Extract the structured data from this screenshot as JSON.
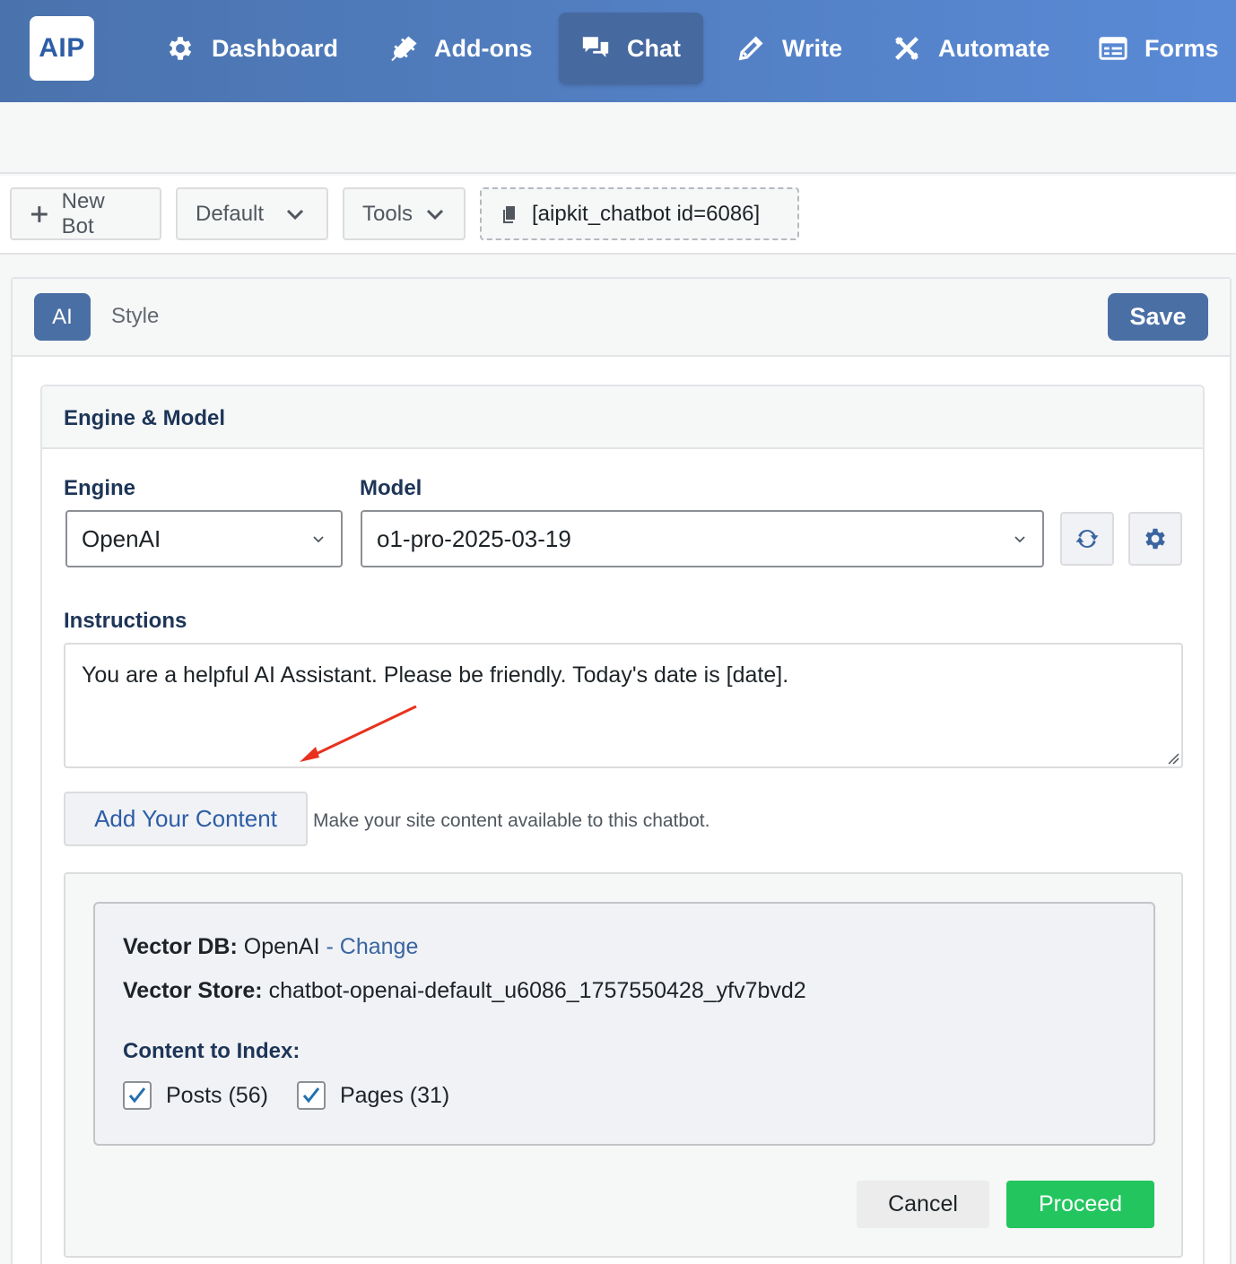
{
  "logo": "AIP",
  "nav": {
    "items": [
      {
        "label": "Dashboard",
        "icon": "gear-icon"
      },
      {
        "label": "Add-ons",
        "icon": "plug-icon"
      },
      {
        "label": "Chat",
        "icon": "chat-icon",
        "active": true
      },
      {
        "label": "Write",
        "icon": "pencil-icon"
      },
      {
        "label": "Automate",
        "icon": "automate-icon"
      },
      {
        "label": "Forms",
        "icon": "form-icon"
      }
    ]
  },
  "toolbar": {
    "new_bot": "New Bot",
    "bot_select": "Default",
    "tools": "Tools",
    "shortcode": "[aipkit_chatbot id=6086]"
  },
  "tabs": {
    "ai": "AI",
    "style": "Style",
    "save": "Save"
  },
  "engine_model": {
    "title": "Engine & Model",
    "engine_label": "Engine",
    "engine_value": "OpenAI",
    "model_label": "Model",
    "model_value": "o1-pro-2025-03-19"
  },
  "instructions": {
    "label": "Instructions",
    "value": "You are a helpful AI Assistant. Please be friendly. Today's date is [date]."
  },
  "content": {
    "add_button": "Add Your Content",
    "description": "Make your site content available to this chatbot.",
    "vector_db_label": "Vector DB:",
    "vector_db_value": "OpenAI",
    "change_link": "- Change",
    "vector_store_label": "Vector Store:",
    "vector_store_value": "chatbot-openai-default_u6086_1757550428_yfv7bvd2",
    "index_label": "Content to Index:",
    "posts": "Posts (56)",
    "pages": "Pages (31)",
    "posts_checked": true,
    "pages_checked": true,
    "cancel": "Cancel",
    "proceed": "Proceed"
  },
  "colors": {
    "nav_gradient_start": "#4a73ad",
    "nav_gradient_end": "#5a8ad6",
    "primary": "#4a6fa5",
    "proceed": "#22c55e",
    "link": "#3a64a0",
    "arrow": "#e8321e"
  }
}
